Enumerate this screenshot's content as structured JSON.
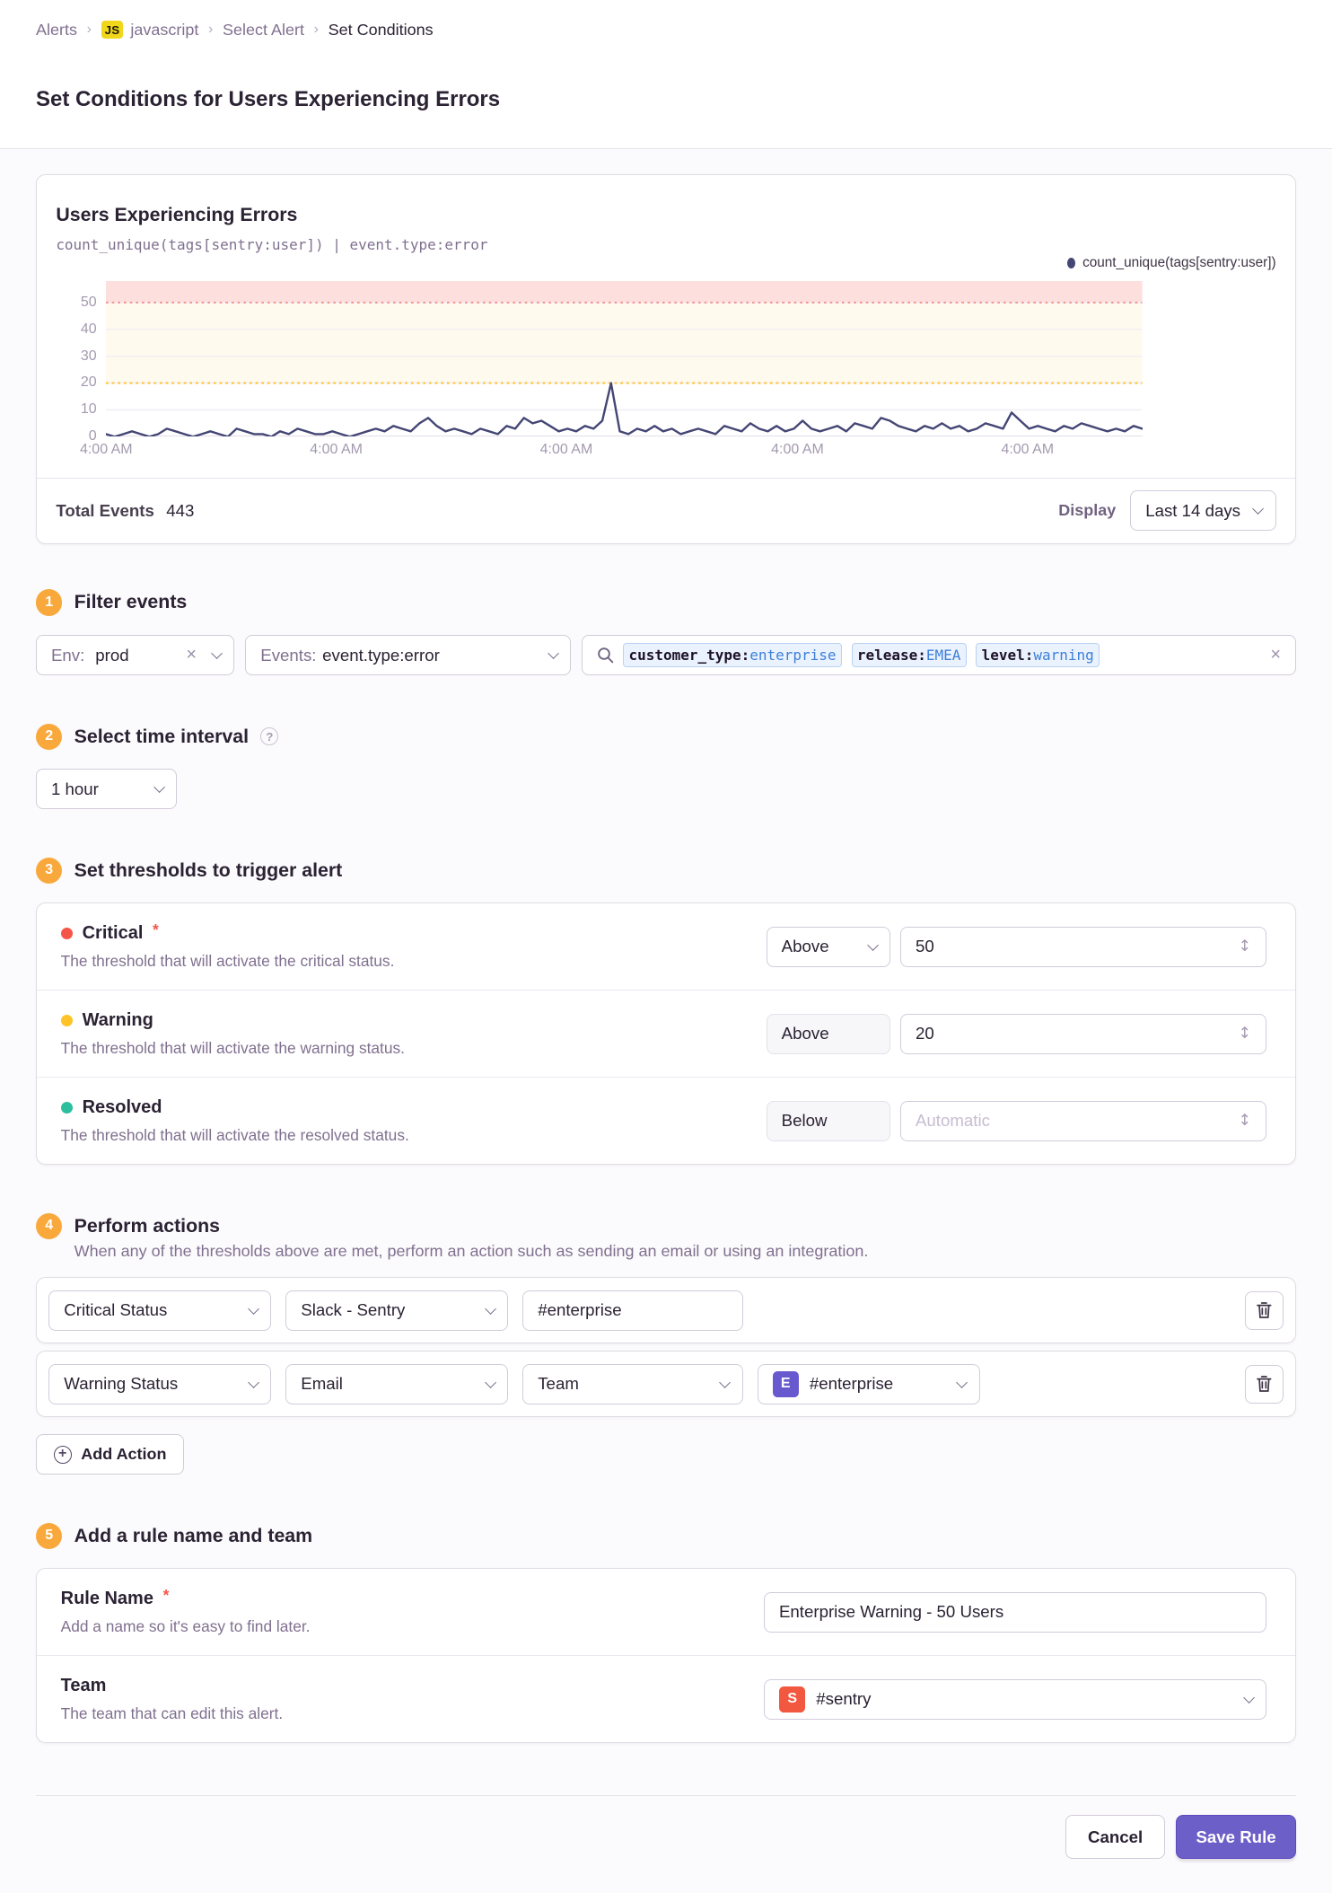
{
  "colors": {
    "critical": "#f55549",
    "warning": "#ffc227",
    "resolved": "#2bbf9e",
    "series": "#444674",
    "accent": "#6c5fc7",
    "step_badge": "#f9a93c"
  },
  "breadcrumb": {
    "items": [
      "Alerts",
      "javascript",
      "Select Alert",
      "Set Conditions"
    ],
    "project_badge": "JS"
  },
  "page": {
    "title": "Set Conditions for Users Experiencing Errors"
  },
  "chart": {
    "title": "Users Experiencing Errors",
    "query": "count_unique(tags[sentry:user]) | event.type:error",
    "legend": "count_unique(tags[sentry:user])",
    "total_events_label": "Total Events",
    "total_events": "443",
    "display_label": "Display",
    "range": "Last 14 days"
  },
  "chart_data": {
    "type": "line",
    "title": "Users Experiencing Errors",
    "series_name": "count_unique(tags[sentry:user])",
    "y_ticks": [
      0,
      10,
      20,
      30,
      40,
      50
    ],
    "y_max": 58,
    "x_tick_labels": [
      "4:00 AM",
      "4:00 AM",
      "4:00 AM",
      "4:00 AM",
      "4:00 AM"
    ],
    "critical_threshold": 50,
    "warning_threshold": 20,
    "values": [
      1,
      0,
      1,
      2,
      1,
      0,
      1,
      3,
      2,
      1,
      0,
      1,
      2,
      1,
      0,
      3,
      2,
      1,
      1,
      0,
      2,
      1,
      3,
      2,
      1,
      1,
      2,
      1,
      0,
      1,
      2,
      3,
      2,
      4,
      3,
      2,
      5,
      7,
      4,
      2,
      3,
      2,
      1,
      3,
      2,
      1,
      4,
      3,
      7,
      5,
      6,
      4,
      2,
      3,
      2,
      4,
      3,
      6,
      20,
      2,
      1,
      3,
      2,
      4,
      2,
      3,
      1,
      2,
      3,
      2,
      1,
      4,
      3,
      2,
      5,
      3,
      2,
      4,
      2,
      3,
      6,
      3,
      2,
      3,
      4,
      2,
      5,
      4,
      3,
      7,
      6,
      4,
      3,
      2,
      4,
      3,
      5,
      3,
      4,
      2,
      3,
      5,
      4,
      3,
      9,
      6,
      3,
      4,
      3,
      2,
      4,
      3,
      5,
      4,
      3,
      2,
      3,
      2,
      4,
      3
    ]
  },
  "sections": {
    "filter": {
      "num": "1",
      "title": "Filter events",
      "env_label": "Env:",
      "env_value": "prod",
      "events_label": "Events:",
      "events_value": "event.type:error",
      "search_tokens": [
        {
          "key": "customer_type:",
          "value": "enterprise"
        },
        {
          "key": "release:",
          "value": "EMEA"
        },
        {
          "key": "level:",
          "value": "warning"
        }
      ]
    },
    "interval": {
      "num": "2",
      "title": "Select time interval",
      "value": "1 hour"
    },
    "thresholds": {
      "num": "3",
      "title": "Set thresholds to trigger alert",
      "rows": [
        {
          "name": "Critical",
          "required": "*",
          "desc": "The threshold that will activate the critical status.",
          "op": "Above",
          "value": "50"
        },
        {
          "name": "Warning",
          "desc": "The threshold that will activate the warning status.",
          "op": "Above",
          "value": "20"
        },
        {
          "name": "Resolved",
          "desc": "The threshold that will activate the resolved status.",
          "op": "Below",
          "placeholder": "Automatic"
        }
      ]
    },
    "actions": {
      "num": "4",
      "title": "Perform actions",
      "subtitle": "When any of the thresholds above are met, perform an action such as sending an email or using an integration.",
      "rows": [
        {
          "trigger": "Critical Status",
          "service": "Slack - Sentry",
          "target_value": "#enterprise"
        },
        {
          "trigger": "Warning Status",
          "service": "Email",
          "target_type": "Team",
          "team_badge": "E",
          "team": "#enterprise"
        }
      ],
      "add_label": "Add Action"
    },
    "naming": {
      "num": "5",
      "title": "Add a rule name and team",
      "rule_name": {
        "label": "Rule Name",
        "required": "*",
        "desc": "Add a name so it's easy to find later.",
        "value": "Enterprise Warning - 50 Users"
      },
      "team": {
        "label": "Team",
        "desc": "The team that can edit this alert.",
        "badge": "S",
        "value": "#sentry"
      }
    }
  },
  "footer": {
    "cancel": "Cancel",
    "save": "Save Rule"
  }
}
